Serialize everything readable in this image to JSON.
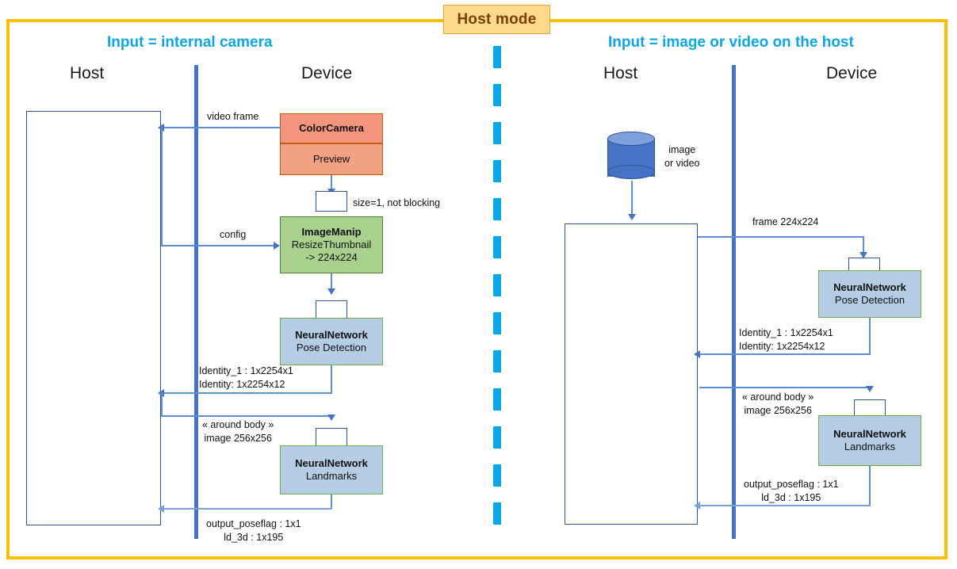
{
  "diagram": {
    "badge_title": "Host mode",
    "frame_color": "#FCC000",
    "accent_color": "#0DA6E8",
    "panels": [
      {
        "id": "left",
        "title": "Input = internal camera",
        "host_label": "Host",
        "device_label": "Device",
        "nodes": [
          {
            "id": "colorcamera",
            "title": "ColorCamera",
            "subtitle": "",
            "color": "#F3957C"
          },
          {
            "id": "preview",
            "title": "Preview",
            "subtitle": "",
            "color": "#F3A183"
          },
          {
            "id": "imagemanip",
            "title": "ImageManip",
            "line2": "ResizeThumbnail",
            "line3": "-> 224x224",
            "color": "#A9D18E"
          },
          {
            "id": "nn-pose",
            "title": "NeuralNetwork",
            "subtitle": "Pose Detection",
            "color": "#B4CDE5"
          },
          {
            "id": "nn-landmarks",
            "title": "NeuralNetwork",
            "subtitle": "Landmarks",
            "color": "#B4CDE5"
          }
        ],
        "edges": [
          {
            "id": "video-frame",
            "label": "video frame"
          },
          {
            "id": "queue-note",
            "label": "size=1, not blocking"
          },
          {
            "id": "config",
            "label": "config"
          },
          {
            "id": "identity-out",
            "line1": "Identity_1 : 1x2254x1",
            "line2": "Identity: 1x2254x12"
          },
          {
            "id": "around-body",
            "line1": "« around body »",
            "line2": "image 256x256"
          },
          {
            "id": "landmark-out",
            "line1": "output_poseflag : 1x1",
            "line2": "ld_3d : 1x195"
          }
        ]
      },
      {
        "id": "right",
        "title": "Input = image or video on the host",
        "host_label": "Host",
        "device_label": "Device",
        "source_label_line1": "image",
        "source_label_line2": "or video",
        "nodes": [
          {
            "id": "nn-pose",
            "title": "NeuralNetwork",
            "subtitle": "Pose Detection",
            "color": "#B4CDE5"
          },
          {
            "id": "nn-landmarks",
            "title": "NeuralNetwork",
            "subtitle": "Landmarks",
            "color": "#B4CDE5"
          }
        ],
        "edges": [
          {
            "id": "frame-in",
            "label": "frame 224x224"
          },
          {
            "id": "identity-out",
            "line1": "Identity_1 : 1x2254x1",
            "line2": "Identity: 1x2254x12"
          },
          {
            "id": "around-body",
            "line1": "« around body »",
            "line2": "image 256x256"
          },
          {
            "id": "landmark-out",
            "line1": "output_poseflag : 1x1",
            "line2": "ld_3d : 1x195"
          }
        ]
      }
    ]
  }
}
